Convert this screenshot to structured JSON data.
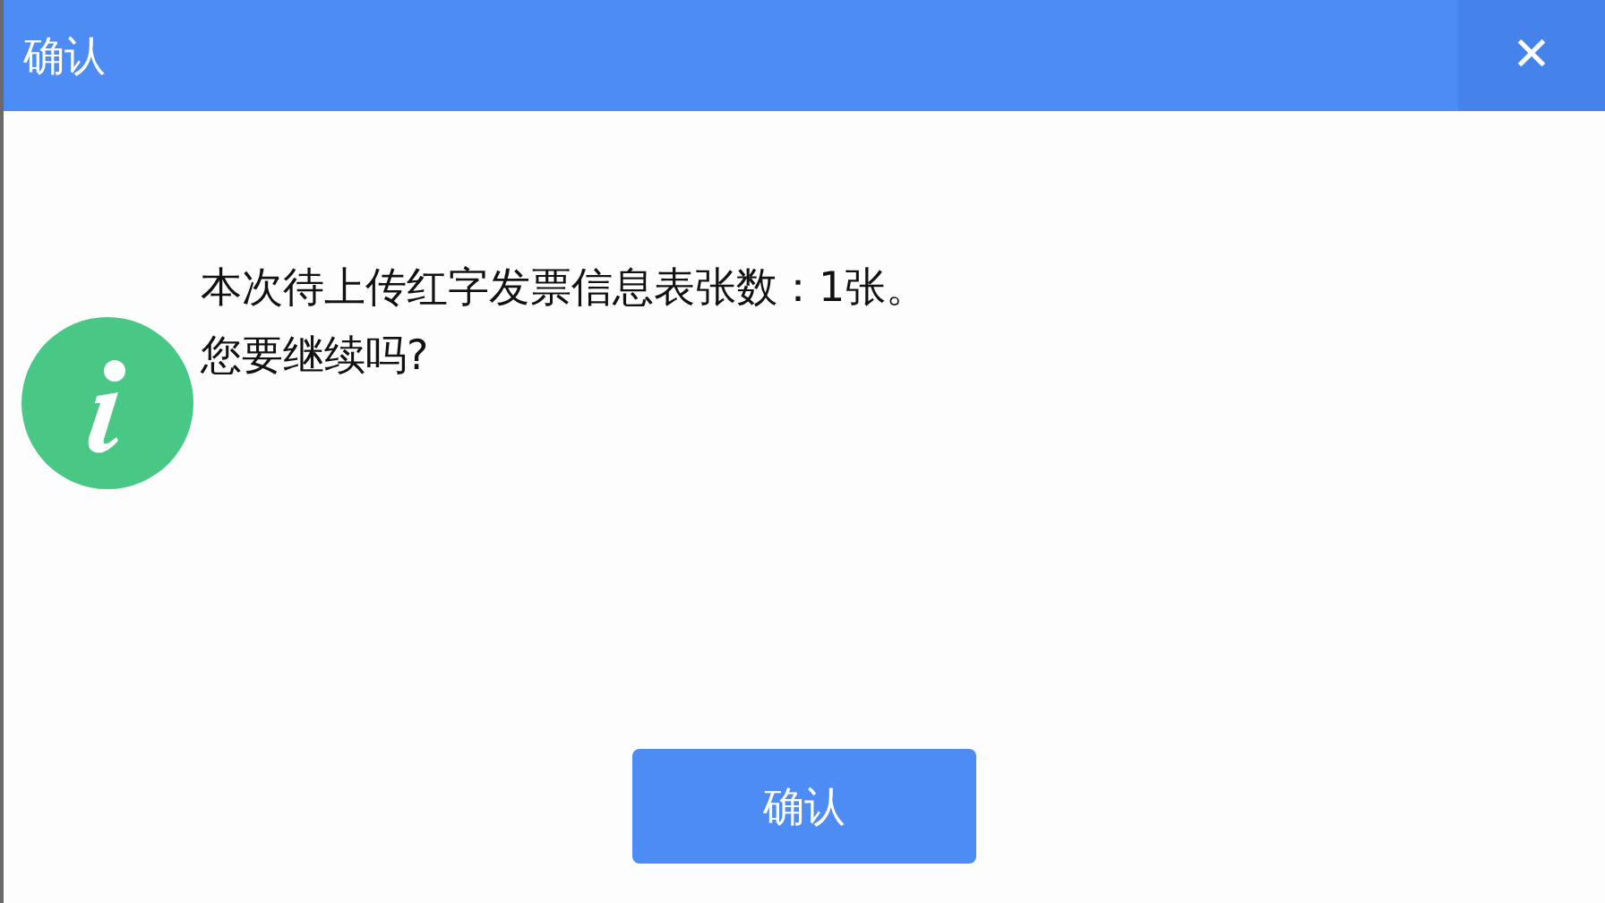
{
  "window": {
    "title": "确认",
    "close": "✕"
  },
  "message": {
    "lines": [
      "本次待上传红字发票信息表张数：1张。",
      "您要继续吗?"
    ]
  },
  "buttons": [
    "确认"
  ]
}
